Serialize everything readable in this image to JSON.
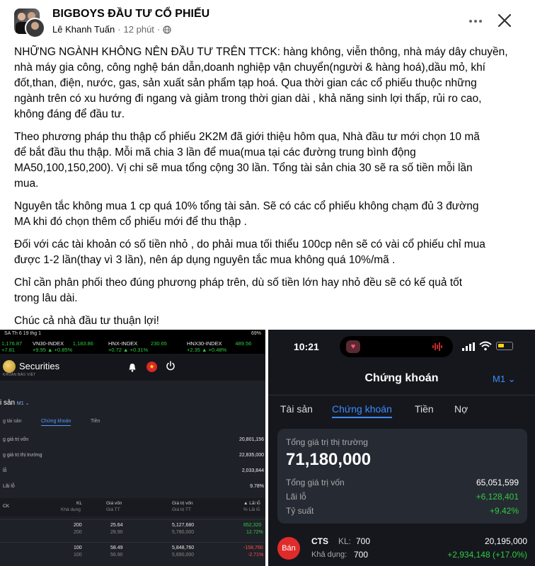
{
  "post": {
    "page_name": "BIGBOYS ĐẦU TƯ CỔ PHIẾU",
    "author": "Lê Khanh Tuấn",
    "time": "12 phút",
    "dot": "·",
    "paragraphs": [
      [
        "NHỮNG NGÀNH KHÔNG NÊN ĐẦU TƯ TRÊN TTCK: hàng không, viễn thông, nhà máy dây chuyền,",
        "nhà máy gia công, công nghệ bán dẫn,doanh nghiệp vận chuyển(người & hàng hoá),dầu mỏ, khí",
        "đốt,than, điện, nước, gas, sản xuất sản phẩm tạp hoá. Qua thời gian các cổ phiếu thuộc những",
        "ngành trên có xu hướng đi ngang và giảm trong thời gian dài , khả năng sinh lợi thấp, rủi ro cao,",
        "không đáng để đầu tư."
      ],
      [
        "Theo phương pháp thu thập cổ phiếu 2K2M đã giới thiệu hôm qua, Nhà đầu tư mới chọn 10 mã",
        "để bắt đầu thu thập. Mỗi mã chia 3 lần để mua(mua tại các đường trung bình động",
        "MA50,100,150,200). Vị chi sẽ mua tổng cộng 30 lần. Tổng tài sản chia 30 sẽ ra số tiền mỗi lần",
        "mua."
      ],
      [
        "Nguyên tắc không mua 1 cp quá 10% tổng tài sản. Sẽ có các cổ phiếu không chạm đủ 3 đường",
        "MA khi đó chọn thêm cổ phiếu mới để thu thập ."
      ],
      [
        "Đối với các tài khoản có số tiền nhỏ , do phải mua tối thiểu 100cp nên sẽ có vài cổ phiếu chỉ mua",
        "được 1-2 lần(thay vì 3 lần), nên áp dụng nguyên tắc mua không quá 10%/mã ."
      ],
      [
        "Chỉ cần phân phối theo đúng phương pháp trên, dù số tiền lớn hay nhỏ đều sẽ có kế quả tốt",
        "trong lâu dài."
      ],
      [
        "Chúc cả nhà đầu tư thuận lợi!"
      ]
    ]
  },
  "left_shot": {
    "status_left": "SA  Th 6 19 thg 1",
    "status_right": "69%",
    "tickers": [
      {
        "name": "",
        "value": "1,176.87",
        "change": "+7.81"
      },
      {
        "name": "VN30-INDEX",
        "value": "1,183.86",
        "change": "+9.95  ▲ +0.85%"
      },
      {
        "name": "HNX-INDEX",
        "value": "230.65",
        "change": "+0.72  ▲ +0.31%"
      },
      {
        "name": "HNX30-INDEX",
        "value": "489.56",
        "change": "+2.35  ▲ +0.48%"
      }
    ],
    "brand": "Securities",
    "brand_sub": "KHOÁN BẢO VIỆT",
    "title": "i sản",
    "title_sub": "M1 ⌄",
    "tabs": [
      "g tài sản",
      "Chứng khoán",
      "Tiền"
    ],
    "summary": [
      {
        "label": "g giá trị vốn",
        "value": "20,801,156",
        "color": "#eeeeee"
      },
      {
        "label": "g giá trị thị trường",
        "value": "22,835,000",
        "color": "#eeeeee"
      },
      {
        "label": "lỗ",
        "value": "2,033,844",
        "color": "#2ecc40"
      },
      {
        "label": "Lãi lỗ",
        "value": "9.78%",
        "color": "#2ecc40"
      }
    ],
    "table_header": {
      "ck": "CK",
      "kl": "KL",
      "kl_sub": "Khả dụng",
      "gv": "Giá vốn",
      "gv_sub": "Giá TT",
      "gtv": "Giá trị vốn",
      "gtv_sub": "Giá trị TT",
      "ll": "▲ Lãi lỗ",
      "ll_sub": "% Lãi lỗ"
    },
    "rows": [
      {
        "ck": "",
        "kl": "200",
        "kl2": "200",
        "gv": "25.64",
        "gv2": "28.90",
        "gtv": "5,127,680",
        "gtv2": "5,780,000",
        "ll": "652,320",
        "ll2": "12.72%",
        "color": "#2ecc40"
      },
      {
        "ck": "",
        "kl": "100",
        "kl2": "100",
        "gv": "58.49",
        "gv2": "56.90",
        "gtv": "5,848,760",
        "gtv2": "5,690,000",
        "ll": "-158,760",
        "ll2": "-2.71%",
        "color": "#ff4d4d"
      }
    ]
  },
  "right_shot": {
    "time": "10:21",
    "title": "Chứng khoán",
    "account": "M1 ⌄",
    "tabs": [
      "Tài sản",
      "Chứng khoán",
      "Tiền",
      "Nợ"
    ],
    "market_value_label": "Tổng giá trị thị trường",
    "market_value": "71,180,000",
    "cost_label": "Tổng giá trị vốn",
    "cost": "65,051,599",
    "pnl_label": "Lãi lỗ",
    "pnl": "+6,128,401",
    "ratio_label": "Tỷ suất",
    "ratio": "+9.42%",
    "stock": {
      "sell": "Bán",
      "symbol": "CTS",
      "kl_label": "KL:",
      "kl": "700",
      "avail_label": "Khả dụng:",
      "avail": "700",
      "value": "20,195,000",
      "pnl": "+2,934,148 (+17.0%)"
    },
    "colors": {
      "accent": "#3d8bff",
      "positive": "#2ecc40",
      "sell": "#e02b2b"
    }
  }
}
